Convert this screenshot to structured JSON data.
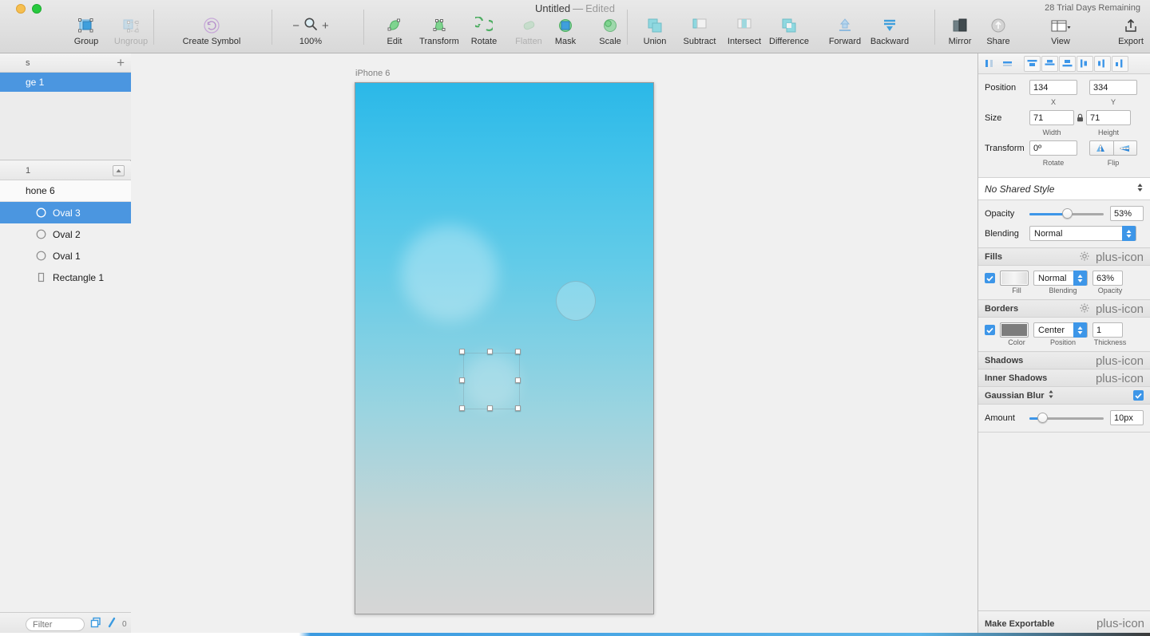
{
  "window": {
    "title": "Untitled",
    "separator": "—",
    "edited": "Edited",
    "trial": "28 Trial Days Remaining"
  },
  "toolbar": {
    "groups": [
      {
        "name": "group",
        "label": "Group",
        "icon": "group-icon",
        "disabled": false
      },
      {
        "name": "ungroup",
        "label": "Ungroup",
        "icon": "ungroup-icon",
        "disabled": true
      },
      {
        "name": "create-symbol",
        "label": "Create Symbol",
        "icon": "symbol-icon",
        "disabled": false
      },
      {
        "name": "edit",
        "label": "Edit",
        "icon": "edit-icon",
        "disabled": false
      },
      {
        "name": "transform",
        "label": "Transform",
        "icon": "transform-icon",
        "disabled": false
      },
      {
        "name": "rotate",
        "label": "Rotate",
        "icon": "rotate-icon",
        "disabled": false
      },
      {
        "name": "flatten",
        "label": "Flatten",
        "icon": "flatten-icon",
        "disabled": true
      },
      {
        "name": "mask",
        "label": "Mask",
        "icon": "mask-icon",
        "disabled": false
      },
      {
        "name": "scale",
        "label": "Scale",
        "icon": "scale-icon",
        "disabled": false
      },
      {
        "name": "union",
        "label": "Union",
        "icon": "union-icon",
        "disabled": true
      },
      {
        "name": "subtract",
        "label": "Subtract",
        "icon": "subtract-icon",
        "disabled": true
      },
      {
        "name": "intersect",
        "label": "Intersect",
        "icon": "intersect-icon",
        "disabled": true
      },
      {
        "name": "difference",
        "label": "Difference",
        "icon": "difference-icon",
        "disabled": true
      },
      {
        "name": "forward",
        "label": "Forward",
        "icon": "forward-icon",
        "disabled": true
      },
      {
        "name": "backward",
        "label": "Backward",
        "icon": "backward-icon",
        "disabled": false
      },
      {
        "name": "mirror",
        "label": "Mirror",
        "icon": "mirror-icon",
        "disabled": false
      },
      {
        "name": "share",
        "label": "Share",
        "icon": "share-icon",
        "disabled": false
      },
      {
        "name": "view",
        "label": "View",
        "icon": "view-icon",
        "disabled": false
      },
      {
        "name": "export",
        "label": "Export",
        "icon": "export-icon",
        "disabled": false
      }
    ],
    "zoom": {
      "label": "100%",
      "minus": "−",
      "plus": "+"
    }
  },
  "left_panel": {
    "pages_header": "s",
    "pages_add": "+",
    "pages": [
      {
        "label": "ge 1",
        "selected": true
      }
    ],
    "layers_header": "1",
    "artboard": "hone 6",
    "layers": [
      {
        "label": "Oval 3",
        "icon": "oval-icon",
        "selected": true
      },
      {
        "label": "Oval 2",
        "icon": "oval-icon",
        "selected": false
      },
      {
        "label": "Oval 1",
        "icon": "oval-icon",
        "selected": false
      },
      {
        "label": "Rectangle 1",
        "icon": "rectangle-icon",
        "selected": false
      }
    ],
    "filter_placeholder": "Filter",
    "count": "0"
  },
  "canvas": {
    "artboard_label": "iPhone 6",
    "zoom_percent": "100%"
  },
  "inspector": {
    "align_buttons": [
      "align-left-icon",
      "align-center-horizontal-icon",
      "align-top-icon",
      "align-middle-icon",
      "align-bottom-icon",
      "distribute-left-icon",
      "distribute-center-icon",
      "distribute-right-icon"
    ],
    "position": {
      "label": "Position",
      "x_value": "134",
      "x_caption": "X",
      "y_value": "334",
      "y_caption": "Y"
    },
    "size": {
      "label": "Size",
      "width_value": "71",
      "width_caption": "Width",
      "height_value": "71",
      "height_caption": "Height",
      "lock_icon": "lock-icon"
    },
    "transform": {
      "label": "Transform",
      "rotate_value": "0º",
      "rotate_caption": "Rotate",
      "flip_caption": "Flip",
      "flip_horizontal_icon": "flip-horizontal-icon",
      "flip_vertical_icon": "flip-vertical-icon"
    },
    "shared_style": {
      "label": "No Shared Style",
      "icon": "chevron-updown-icon"
    },
    "appearance": {
      "opacity_label": "Opacity",
      "opacity_value": "53%",
      "opacity_percent": 53,
      "blending_label": "Blending",
      "blending_value": "Normal"
    },
    "fills": {
      "title": "Fills",
      "gear_icon": "gear-icon",
      "add_icon": "plus-icon",
      "enabled": true,
      "fill_caption": "Fill",
      "blending_value": "Normal",
      "blending_caption": "Blending",
      "opacity_value": "63%",
      "opacity_caption": "Opacity"
    },
    "borders": {
      "title": "Borders",
      "gear_icon": "gear-icon",
      "add_icon": "plus-icon",
      "enabled": true,
      "color_caption": "Color",
      "color_hex": "#7d7d7d",
      "position_value": "Center",
      "position_caption": "Position",
      "thickness_value": "1",
      "thickness_caption": "Thickness"
    },
    "shadows": {
      "title": "Shadows",
      "add_icon": "plus-icon"
    },
    "inner_shadows": {
      "title": "Inner Shadows",
      "add_icon": "plus-icon"
    },
    "blur": {
      "title": "Gaussian Blur",
      "chevron_icon": "chevron-updown-icon",
      "enabled": true,
      "amount_label": "Amount",
      "amount_value": "10px",
      "amount_percent": 12
    },
    "make_exportable": {
      "title": "Make Exportable",
      "add_icon": "plus-icon"
    }
  }
}
